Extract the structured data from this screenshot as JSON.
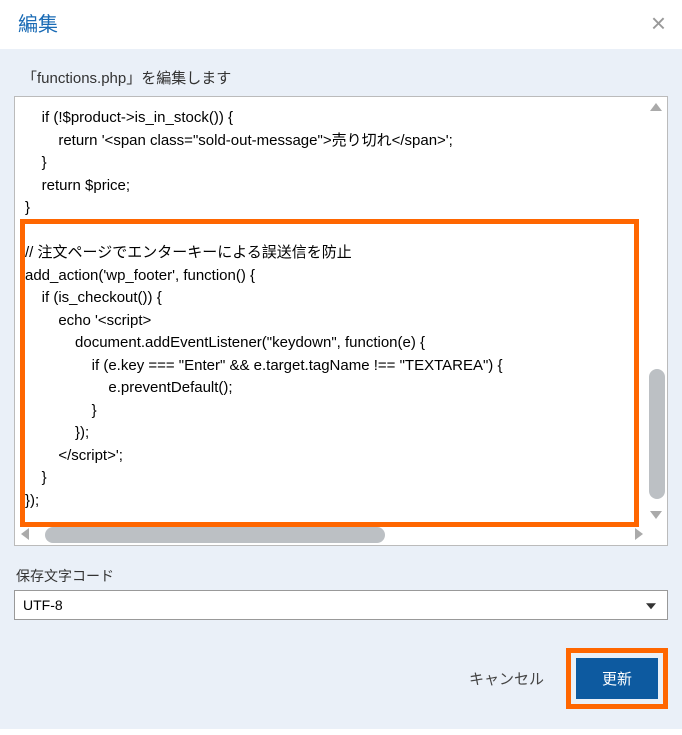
{
  "header": {
    "title": "編集",
    "close_label": "×"
  },
  "body": {
    "file_description": "「functions.php」を編集します",
    "code": "    if (!$product->is_in_stock()) {\n        return '<span class=\"sold-out-message\">売り切れ</span>';\n    }\n    return $price;\n}\n\n// 注文ページでエンターキーによる誤送信を防止\nadd_action('wp_footer', function() {\n    if (is_checkout()) {\n        echo '<script>\n            document.addEventListener(\"keydown\", function(e) {\n                if (e.key === \"Enter\" && e.target.tagName !== \"TEXTAREA\") {\n                    e.preventDefault();\n                }\n            });\n        </script>';\n    }\n});"
  },
  "encoding": {
    "label": "保存文字コード",
    "value": "UTF-8"
  },
  "buttons": {
    "cancel": "キャンセル",
    "update": "更新"
  }
}
